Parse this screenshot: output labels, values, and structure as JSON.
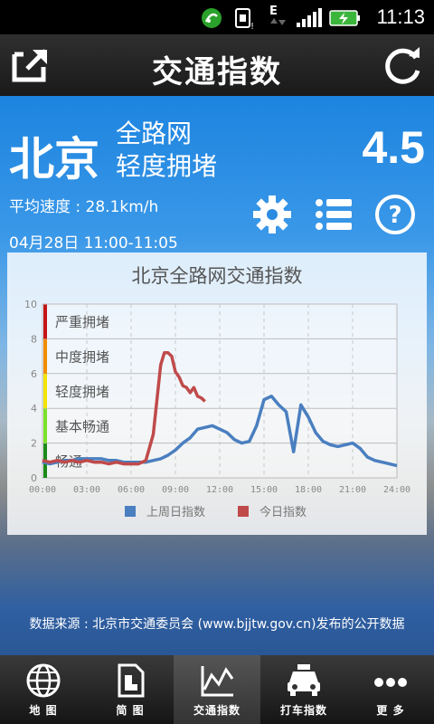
{
  "status_bar": {
    "time": "11:13",
    "signal_label": "E"
  },
  "header": {
    "title": "交通指数",
    "share_icon": "share-icon",
    "refresh_icon": "refresh-icon"
  },
  "summary": {
    "city": "北京",
    "scope": "全路网",
    "level": "轻度拥堵",
    "index_value": "4.5",
    "avg_speed": "平均速度 : 28.1km/h",
    "time_range": "04月28日 11:00-11:05"
  },
  "actions": {
    "settings_icon": "gear-icon",
    "list_icon": "list-icon",
    "help_icon": "help-icon"
  },
  "chart_data": {
    "type": "line",
    "title": "北京全路网交通指数",
    "ylim": [
      0,
      10
    ],
    "y_ticks": [
      "0",
      "2",
      "4",
      "6",
      "8",
      "10"
    ],
    "x_ticks": [
      "00:00",
      "03:00",
      "06:00",
      "09:00",
      "12:00",
      "15:00",
      "18:00",
      "21:00",
      "24:00"
    ],
    "xlim": [
      0,
      24
    ],
    "grid": true,
    "legend_position": "bottom",
    "bands": [
      {
        "label": "畅通",
        "color": "#1a8a1a",
        "from": 0,
        "to": 2
      },
      {
        "label": "基本畅通",
        "color": "#7be22a",
        "from": 2,
        "to": 4
      },
      {
        "label": "轻度拥堵",
        "color": "#f2e300",
        "from": 4,
        "to": 6
      },
      {
        "label": "中度拥堵",
        "color": "#f28c00",
        "from": 6,
        "to": 8
      },
      {
        "label": "严重拥堵",
        "color": "#c41414",
        "from": 8,
        "to": 10
      }
    ],
    "series": [
      {
        "name": "上周日指数",
        "color": "#4a7fc0",
        "x": [
          0,
          0.5,
          1,
          1.5,
          2,
          2.5,
          3,
          3.5,
          4,
          4.5,
          5,
          5.5,
          6,
          6.5,
          7,
          7.5,
          8,
          8.5,
          9,
          9.5,
          10,
          10.5,
          11,
          11.5,
          12,
          12.5,
          13,
          13.5,
          14,
          14.5,
          15,
          15.5,
          16,
          16.5,
          17,
          17.5,
          18,
          18.5,
          19,
          19.5,
          20,
          20.5,
          21,
          21.5,
          22,
          22.5,
          23,
          23.5,
          24
        ],
        "y": [
          0.9,
          0.8,
          0.9,
          1.0,
          1.0,
          1.1,
          1.1,
          1.1,
          1.1,
          1.0,
          1.0,
          0.9,
          0.9,
          0.9,
          0.9,
          1.0,
          1.1,
          1.3,
          1.6,
          2.0,
          2.3,
          2.8,
          2.9,
          3.0,
          2.8,
          2.6,
          2.2,
          2.0,
          2.1,
          3.0,
          4.5,
          4.7,
          4.2,
          3.8,
          1.5,
          4.2,
          3.5,
          2.6,
          2.1,
          1.9,
          1.8,
          1.9,
          2.0,
          1.7,
          1.2,
          1.0,
          0.9,
          0.8,
          0.7
        ]
      },
      {
        "name": "今日指数",
        "color": "#c04a4a",
        "x": [
          0,
          0.5,
          1,
          1.5,
          2,
          2.5,
          3,
          3.5,
          4,
          4.5,
          5,
          5.5,
          6,
          6.5,
          7,
          7.5,
          8,
          8.25,
          8.5,
          8.75,
          9,
          9.25,
          9.5,
          9.75,
          10,
          10.25,
          10.5,
          10.75,
          11
        ],
        "y": [
          1.0,
          0.9,
          1.0,
          0.9,
          1.0,
          0.9,
          1.0,
          0.9,
          0.9,
          0.8,
          0.9,
          0.8,
          0.8,
          0.8,
          1.0,
          2.5,
          6.5,
          7.2,
          7.2,
          7.0,
          6.1,
          5.8,
          5.3,
          5.2,
          4.9,
          5.2,
          4.7,
          4.6,
          4.4
        ]
      }
    ]
  },
  "source_text": "数据来源 : 北京市交通委员会 (www.bjjtw.gov.cn)发布的公开数据",
  "nav": {
    "items": [
      {
        "label": "地 图",
        "icon": "globe-icon",
        "active": false
      },
      {
        "label": "简 图",
        "icon": "document-icon",
        "active": false
      },
      {
        "label": "交通指数",
        "icon": "chart-icon",
        "active": true
      },
      {
        "label": "打车指数",
        "icon": "taxi-icon",
        "active": false
      },
      {
        "label": "更 多",
        "icon": "more-icon",
        "active": false
      }
    ]
  }
}
